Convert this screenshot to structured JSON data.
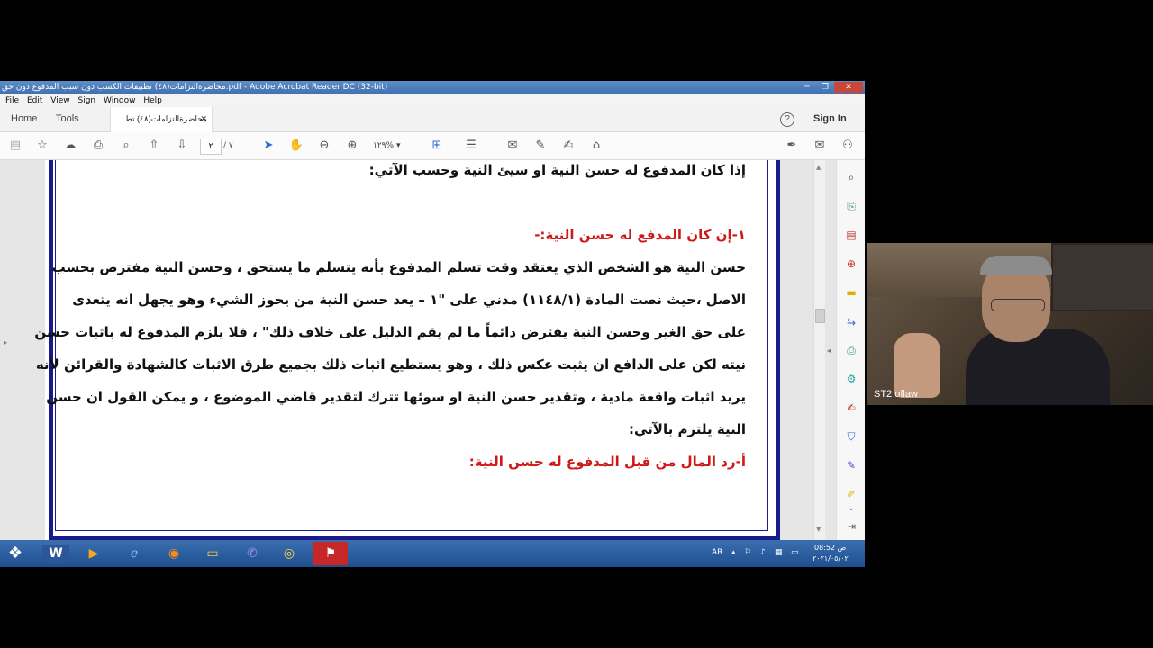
{
  "window": {
    "title": "محاضرةالتزامات(٤٨) تطبيقات الكسب دون سبب المدفوع دون حق.pdf - Adobe Acrobat Reader DC (32-bit)",
    "controls": [
      "─",
      "❐",
      "✕"
    ]
  },
  "menu": [
    "File",
    "Edit",
    "View",
    "Sign",
    "Window",
    "Help"
  ],
  "tabs": {
    "home": "Home",
    "tools": "Tools",
    "doc": "محاضرةالتزامات(٤٨) تط...",
    "close": "✕",
    "help": "?",
    "signin": "Sign In"
  },
  "toolbar": {
    "page_current": "٢",
    "page_total": "/ ٧",
    "zoom": "١٢٩%"
  },
  "document": {
    "lines": [
      "إذا كان المدفوع له حسن النية او سيئ النية وحسب الآتي:",
      "١-إن كان المدفع له حسن النية:-",
      "حسن النية هو الشخص الذي يعتقد وقت تسلم المدفوع بأنه يتسلم ما يستحق ، وحسن النية مفترض بحسب",
      "الاصل ،حيث نصت المادة (١١٤٨/١) مدني على \"١ – يعد حسن النية من يحوز الشيء وهو يجهل انه يتعدى",
      "على حق الغير وحسن النية يفترض دائماً ما لم يقم الدليل على خلاف ذلك\" ، فلا يلزم المدفوع له باثبات حسن",
      "نيته لكن على الدافع ان يثبت عكس ذلك ، وهو يستطيع اثبات ذلك بجميع طرق الاثبات كالشهادة والقرائن لأنه",
      "يريد اثبات واقعة مادية ، وتقدير حسن النية او سوئها تترك لتقدير قاضي الموضوع ، و يمكن القول ان حسن",
      "النية يلتزم بالآتي:",
      "أ-رد المال من قبل المدفوع له حسن النية:"
    ]
  },
  "taskbar": {
    "lang": "AR",
    "time": "ص 08:52",
    "date": "٢٠٢١/٠٥/٠٢"
  },
  "video": {
    "label": "ST2 oflaw"
  },
  "icons": {
    "start": "windows-start-icon",
    "word": "word-icon",
    "media": "media-player-icon",
    "ie": "internet-explorer-icon",
    "firefox": "firefox-icon",
    "folder": "folder-icon",
    "viber": "viber-icon",
    "chrome": "chrome-icon",
    "acrobat": "acrobat-icon"
  }
}
